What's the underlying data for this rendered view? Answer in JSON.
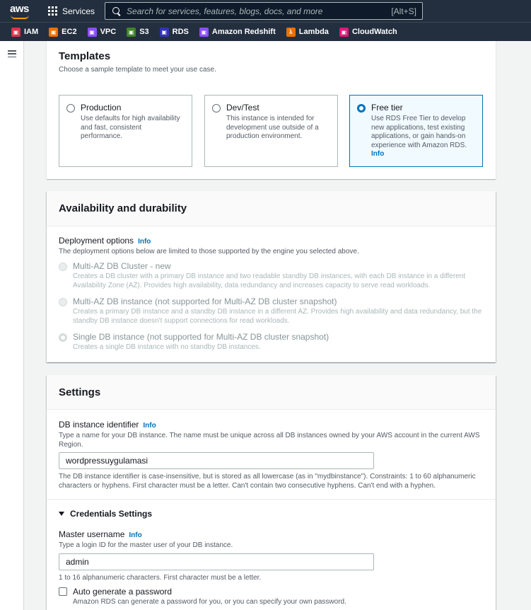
{
  "topnav": {
    "logo_text": "aws",
    "services_label": "Services",
    "search_placeholder": "Search for services, features, blogs, docs, and more",
    "search_shortcut": "[Alt+S]"
  },
  "favorites": [
    {
      "label": "IAM",
      "color": "#dd344c"
    },
    {
      "label": "EC2",
      "color": "#ed7100"
    },
    {
      "label": "VPC",
      "color": "#8c4fff"
    },
    {
      "label": "S3",
      "color": "#3f8624"
    },
    {
      "label": "RDS",
      "color": "#3334b9"
    },
    {
      "label": "Amazon Redshift",
      "color": "#8c4fff"
    },
    {
      "label": "Lambda",
      "color": "#ed7100"
    },
    {
      "label": "CloudWatch",
      "color": "#e7157b"
    }
  ],
  "templates": {
    "title": "Templates",
    "subtitle": "Choose a sample template to meet your use case.",
    "options": [
      {
        "title": "Production",
        "desc": "Use defaults for high availability and fast, consistent performance.",
        "selected": false
      },
      {
        "title": "Dev/Test",
        "desc": "This instance is intended for development use outside of a production environment.",
        "selected": false
      },
      {
        "title": "Free tier",
        "desc": "Use RDS Free Tier to develop new applications, test existing applications, or gain hands-on experience with Amazon RDS.",
        "info": "Info",
        "selected": true
      }
    ]
  },
  "availability": {
    "title": "Availability and durability",
    "deployment_label": "Deployment options",
    "info": "Info",
    "deployment_desc": "The deployment options below are limited to those supported by the engine you selected above.",
    "options": [
      {
        "title": "Multi-AZ DB Cluster - new",
        "desc": "Creates a DB cluster with a primary DB instance and two readable standby DB instances, with each DB instance in a different Availability Zone (AZ). Provides high availability, data redundancy and increases capacity to serve read workloads."
      },
      {
        "title": "Multi-AZ DB instance (not supported for Multi-AZ DB cluster snapshot)",
        "desc": "Creates a primary DB instance and a standby DB instance in a different AZ. Provides high availability and data redundancy, but the standby DB instance doesn't support connections for read workloads."
      },
      {
        "title": "Single DB instance (not supported for Multi-AZ DB cluster snapshot)",
        "desc": "Creates a single DB instance with no standby DB instances."
      }
    ]
  },
  "settings": {
    "title": "Settings",
    "db_identifier_label": "DB instance identifier",
    "info": "Info",
    "db_identifier_desc": "Type a name for your DB instance. The name must be unique across all DB instances owned by your AWS account in the current AWS Region.",
    "db_identifier_value": "wordpressuygulamasi",
    "db_identifier_constraints": "The DB instance identifier is case-insensitive, but is stored as all lowercase (as in \"mydbinstance\"). Constraints: 1 to 60 alphanumeric characters or hyphens. First character must be a letter. Can't contain two consecutive hyphens. Can't end with a hyphen.",
    "credentials_label": "Credentials Settings",
    "master_username_label": "Master username",
    "master_username_desc": "Type a login ID for the master user of your DB instance.",
    "master_username_value": "admin",
    "master_username_constraints": "1 to 16 alphanumeric characters. First character must be a letter.",
    "auto_password_label": "Auto generate a password",
    "auto_password_desc": "Amazon RDS can generate a password for you, or you can specify your own password."
  }
}
